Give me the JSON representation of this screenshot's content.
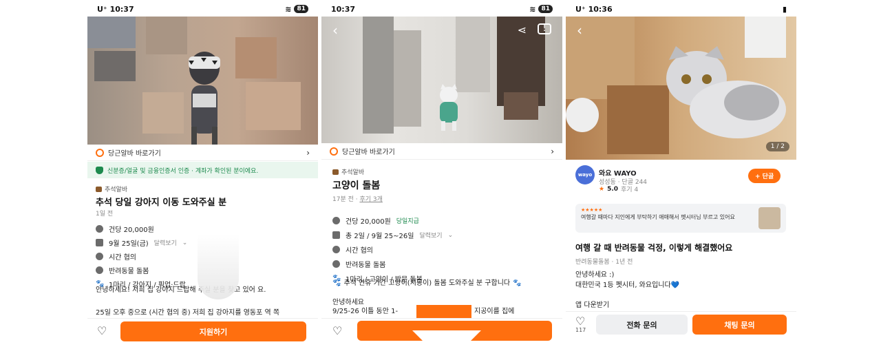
{
  "screen1": {
    "status": {
      "time": "10:37",
      "carrier": "U⁺",
      "battery": "81"
    },
    "link_bar": {
      "label": "당근알바 바로가기"
    },
    "verify_banner": "신분증/얼굴 및 금융인증서 인증 · 계좌가 확인된 분이에요.",
    "category": "추석알바",
    "title": "추석 당일 강아지 이동 도와주실 분",
    "posted": "1일 전",
    "details": {
      "pay": "건당 20,000원",
      "date": "9월 25일(금)",
      "date_more": "달력보기",
      "time": "시간 협의",
      "type": "반려동물 돌봄",
      "count": "1마리 / 강아지 / 픽업·드랍"
    },
    "body": {
      "line1": "안녕하세요! 저희 집 강아지 드랍해 주실 분을 찾고 있어 요.",
      "line2": "25일 오후 중으로 (시간 협의 중) 저희 집 강아지를 영동포 역 쪽"
    },
    "apply_button": "지원하기"
  },
  "screen2": {
    "status": {
      "time": "10:37",
      "battery": "81"
    },
    "link_bar": {
      "label": "당근알바 바로가기"
    },
    "category": "추석알바",
    "title": "고양이 돌봄",
    "posted": "17분 전",
    "reviews": "후기 3개",
    "details": {
      "pay": "건당 20,000원",
      "pay_tag": "당일지급",
      "date": "총 2일 / 9월 25~26일",
      "date_more": "달력보기",
      "time": "시간 협의",
      "type": "반려동물 돌봄",
      "count": "1마리 / 고양이 / 방문 돌봄"
    },
    "highlight": "추석 연휴 기간 고양이(지공이) 돌봄 도와주실 분 구합니다",
    "body": {
      "line1": "안녕하세요",
      "line2_left": "9/25-26 이틀 동안 1-",
      "line2_right": "지공이를 집에"
    }
  },
  "screen3": {
    "status": {
      "time": "10:36",
      "carrier": "U⁺"
    },
    "photo_counter": "1 / 2",
    "author": {
      "avatar_text": "wayo",
      "name": "와요 WAYO",
      "meta": "성성동 · 단골 244",
      "rating": "5.0",
      "reviews": "후기 4"
    },
    "follow_button": "+ 단골",
    "review": {
      "stars": "★★★★★",
      "text": "여행갈 때마다 지인에게 부탁하기 애매해서 펫시터님 부르고 있어요"
    },
    "title": "여행 갈 때 반려동물 걱정, 이렇게 해결했어요",
    "meta": "반려동물돌봄 · 1년 전",
    "body": {
      "line1": "안녕하세요 :)",
      "line2": "대한민국 1등 펫시터, 와요입니다💙"
    },
    "more": "앱 다운받기",
    "like_count": "117",
    "call_button": "전화 문의",
    "chat_button": "채팅 문의"
  },
  "colors": {
    "brand": "#ff6f0f",
    "green": "#1d8a4e"
  }
}
